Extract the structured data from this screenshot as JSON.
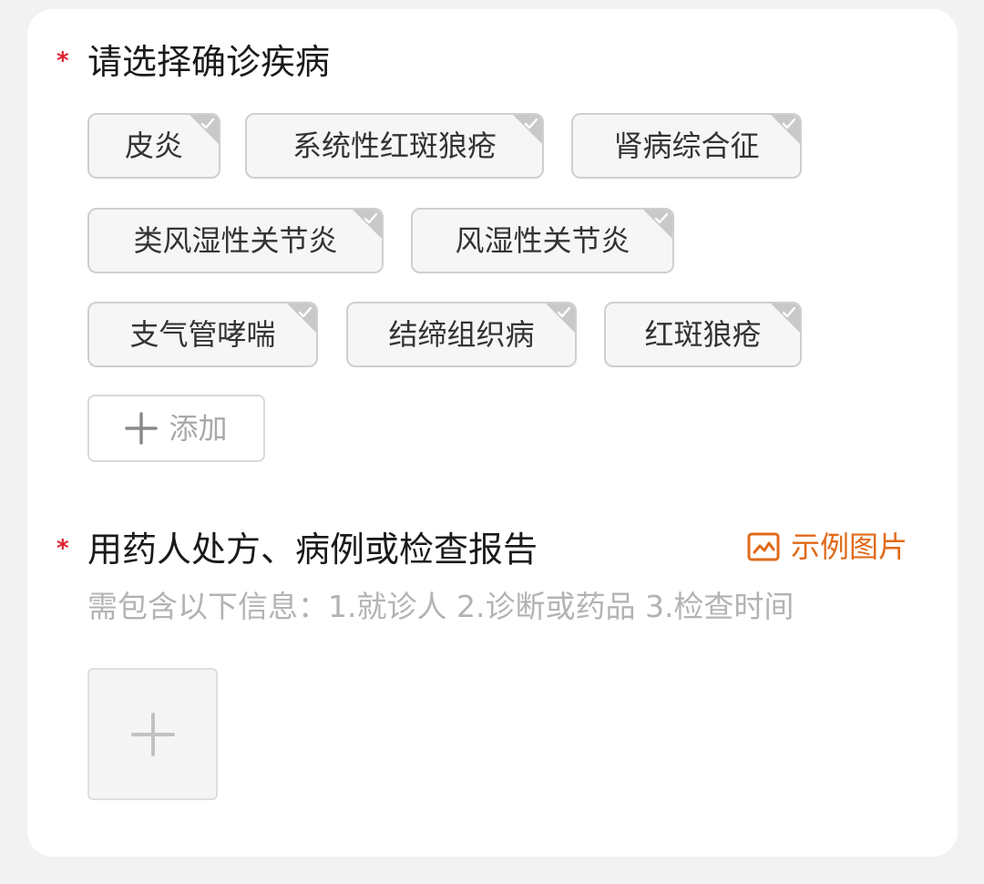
{
  "diagnosis": {
    "required_mark": "*",
    "title": "请选择确诊疾病",
    "tags": [
      {
        "label": "皮炎"
      },
      {
        "label": "系统性红斑狼疮"
      },
      {
        "label": "肾病综合征"
      },
      {
        "label": "类风湿性关节炎"
      },
      {
        "label": "风湿性关节炎"
      },
      {
        "label": "支气管哮喘"
      },
      {
        "label": "结缔组织病"
      },
      {
        "label": "红斑狼疮"
      }
    ],
    "add_label": "添加"
  },
  "prescription": {
    "required_mark": "*",
    "title": "用药人处方、病例或检查报告",
    "example_label": "示例图片",
    "hint": "需包含以下信息：1.就诊人 2.诊断或药品 3.检查时间"
  },
  "colors": {
    "required": "#e0202e",
    "accent": "#e06a1a",
    "tag_border": "#cfcfcf",
    "tag_corner": "#c9c9c9"
  },
  "icons": {
    "tag_check": "check-icon",
    "add": "plus-icon",
    "example": "image-icon",
    "upload": "plus-icon"
  }
}
